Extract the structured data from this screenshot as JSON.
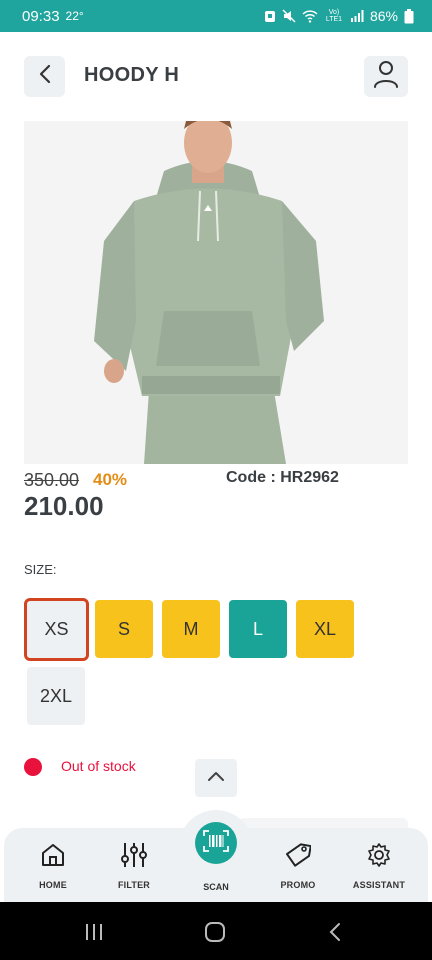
{
  "status_bar": {
    "time": "09:33",
    "temp": "22°",
    "battery": "86%",
    "network": "Vo) LTE1"
  },
  "header": {
    "title": "HOODY H"
  },
  "product": {
    "old_price": "350.00",
    "discount": "40%",
    "code": "Code : HR2962",
    "price": "210.00"
  },
  "sizes": {
    "label": "SIZE:",
    "options": [
      "XS",
      "S",
      "M",
      "L",
      "XL",
      "2XL"
    ],
    "selected": "XS"
  },
  "stock": {
    "text": "Out of stock"
  },
  "bottom_nav": {
    "items": [
      {
        "label": "HOME",
        "icon": "home-icon"
      },
      {
        "label": "FILTER",
        "icon": "filter-icon"
      },
      {
        "label": "SCAN",
        "icon": "barcode-icon"
      },
      {
        "label": "PROMO",
        "icon": "tag-icon"
      },
      {
        "label": "ASSISTANT",
        "icon": "gear-icon"
      }
    ]
  },
  "colors": {
    "status_bar": "#1fa59d",
    "accent": "#1aa397",
    "size_available": "#f8c21c",
    "selected_border": "#d24420",
    "out_of_stock": "#e8123d",
    "discount": "#e38d17"
  }
}
